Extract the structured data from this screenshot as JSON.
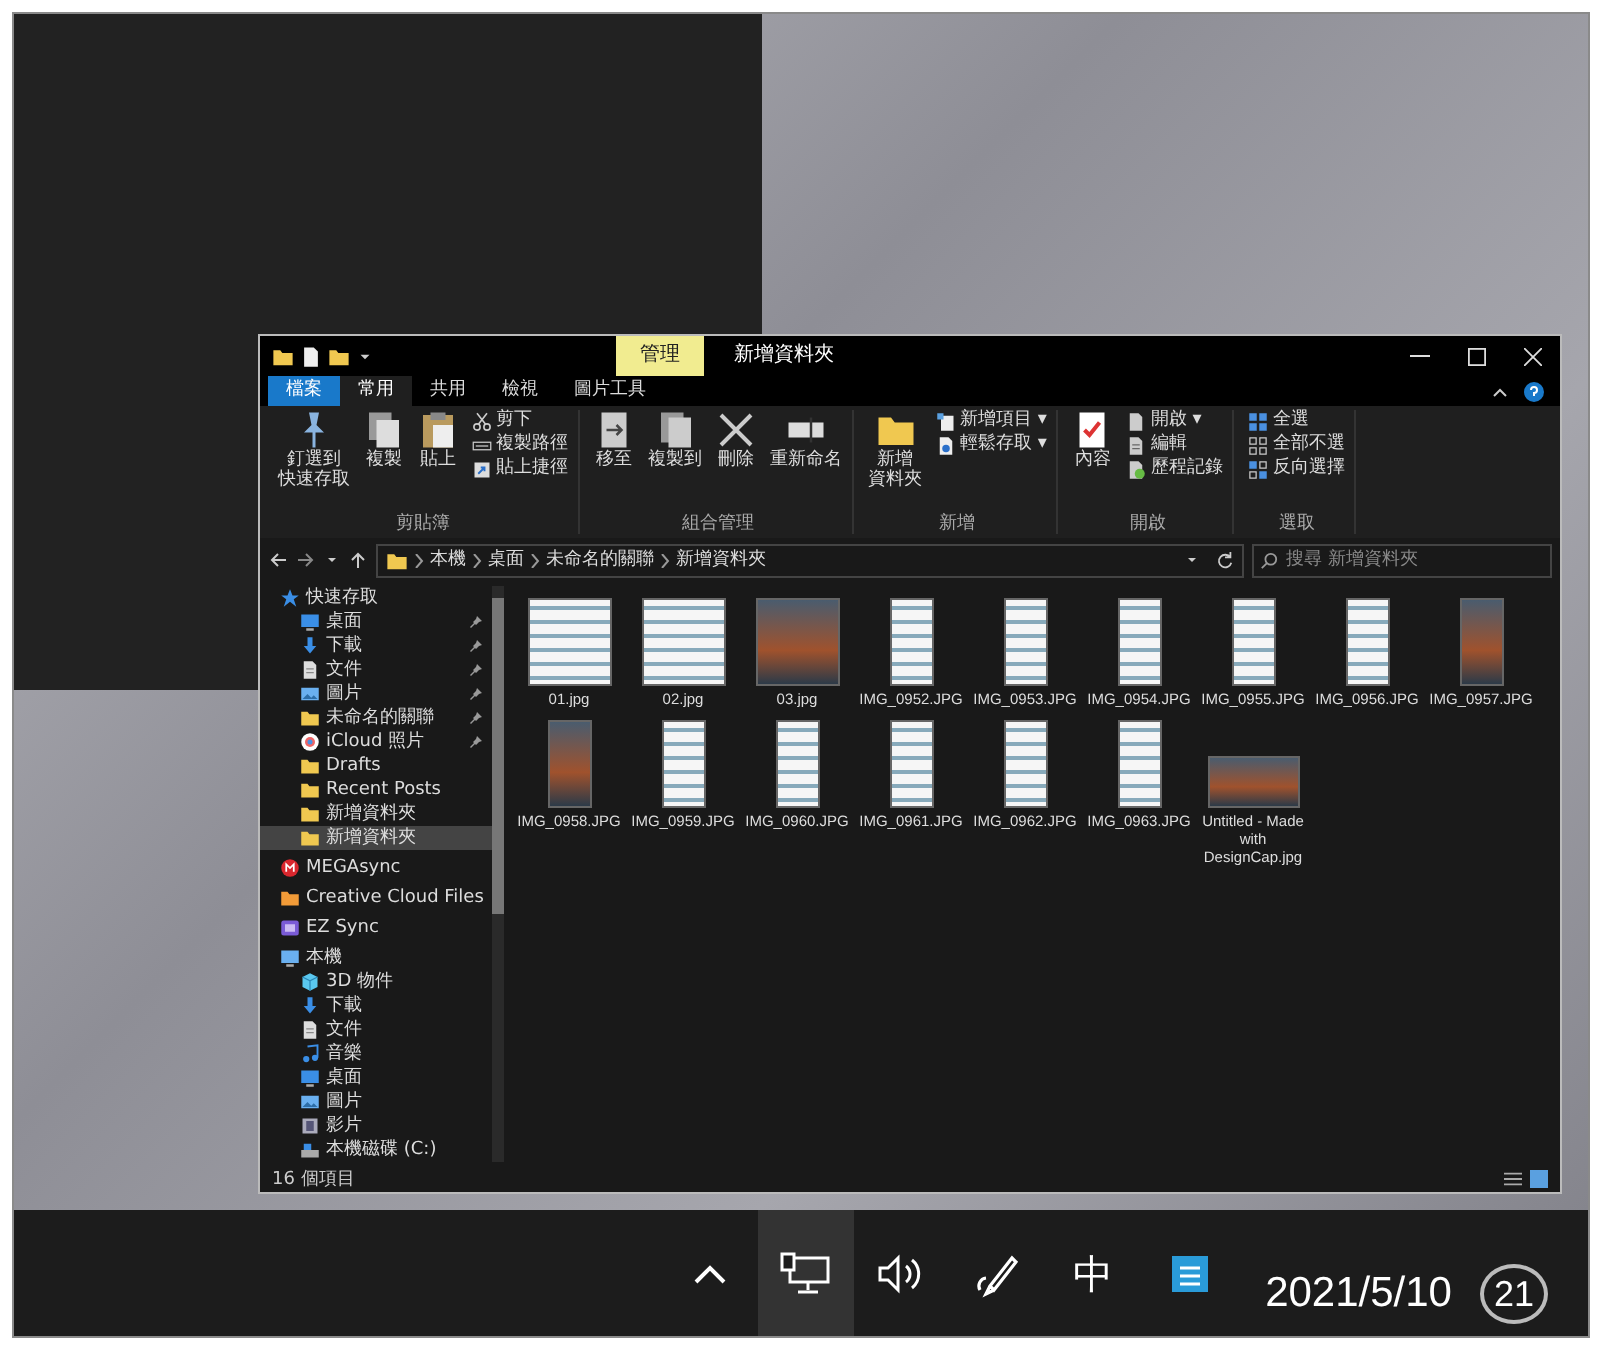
{
  "explorer": {
    "context_tab": "管理",
    "title": "新增資料夾",
    "ribbon_tabs": [
      {
        "label": "檔案",
        "kind": "file",
        "selected": false
      },
      {
        "label": "常用",
        "kind": "tab",
        "selected": true
      },
      {
        "label": "共用",
        "kind": "tab",
        "selected": false
      },
      {
        "label": "檢視",
        "kind": "tab",
        "selected": false
      },
      {
        "label": "圖片工具",
        "kind": "tab",
        "selected": false
      }
    ],
    "ribbon_groups": [
      {
        "name": "剪貼簿",
        "items": [
          {
            "lines": [
              "釘選到",
              "快速存取"
            ],
            "kind": "pin",
            "large": true
          },
          {
            "lines": [
              "複製"
            ],
            "kind": "copy",
            "large": true
          },
          {
            "lines": [
              "貼上"
            ],
            "kind": "paste",
            "large": true
          },
          {
            "lines": [
              "剪下"
            ],
            "kind": "cut",
            "large": false
          },
          {
            "lines": [
              "複製路徑"
            ],
            "kind": "path",
            "large": false
          },
          {
            "lines": [
              "貼上捷徑"
            ],
            "kind": "shortcut",
            "large": false
          }
        ]
      },
      {
        "name": "組合管理",
        "items": [
          {
            "lines": [
              "移至"
            ],
            "kind": "move",
            "large": true
          },
          {
            "lines": [
              "複製到"
            ],
            "kind": "copyto",
            "large": true
          },
          {
            "lines": [
              "刪除"
            ],
            "kind": "delete",
            "large": true
          },
          {
            "lines": [
              "重新命名"
            ],
            "kind": "rename",
            "large": true
          }
        ]
      },
      {
        "name": "新增",
        "items": [
          {
            "lines": [
              "新增",
              "資料夾"
            ],
            "kind": "folder",
            "large": true
          },
          {
            "lines": [
              "新增項目 ▾"
            ],
            "kind": "newitem",
            "large": false
          },
          {
            "lines": [
              "輕鬆存取 ▾"
            ],
            "kind": "easy",
            "large": false
          }
        ]
      },
      {
        "name": "開啟",
        "items": [
          {
            "lines": [
              "內容"
            ],
            "kind": "properties",
            "large": true
          },
          {
            "lines": [
              "開啟 ▾"
            ],
            "kind": "open",
            "large": false
          },
          {
            "lines": [
              "編輯"
            ],
            "kind": "edit",
            "large": false
          },
          {
            "lines": [
              "歷程記錄"
            ],
            "kind": "history",
            "large": false
          }
        ]
      },
      {
        "name": "選取",
        "items": [
          {
            "lines": [
              "全選"
            ],
            "kind": "selectall",
            "large": false
          },
          {
            "lines": [
              "全部不選"
            ],
            "kind": "selectnone",
            "large": false
          },
          {
            "lines": [
              "反向選擇"
            ],
            "kind": "invert",
            "large": false
          }
        ]
      }
    ],
    "breadcrumbs": [
      "本機",
      "桌面",
      "未命名的關聯",
      "新增資料夾"
    ],
    "search": {
      "placeholder": "搜尋 新增資料夾"
    },
    "sidebar": {
      "groups": [
        [
          {
            "label": "快速存取",
            "kind": "star",
            "pinned": false,
            "selected": false
          },
          {
            "label": "桌面",
            "kind": "desktop",
            "pinned": true,
            "selected": false
          },
          {
            "label": "下載",
            "kind": "download",
            "pinned": true,
            "selected": false
          },
          {
            "label": "文件",
            "kind": "document",
            "pinned": true,
            "selected": false
          },
          {
            "label": "圖片",
            "kind": "pictures",
            "pinned": true,
            "selected": false
          },
          {
            "label": "未命名的關聯",
            "kind": "folder",
            "pinned": true,
            "selected": false
          },
          {
            "label": "iCloud 照片",
            "kind": "cloud",
            "pinned": true,
            "selected": false
          },
          {
            "label": "Drafts",
            "kind": "folder",
            "pinned": false,
            "selected": false
          },
          {
            "label": "Recent Posts",
            "kind": "folder",
            "pinned": false,
            "selected": false
          },
          {
            "label": "新增資料夾",
            "kind": "folder",
            "pinned": false,
            "selected": false
          },
          {
            "label": "新增資料夾",
            "kind": "folder",
            "pinned": false,
            "selected": true
          }
        ],
        [
          {
            "label": "MEGAsync",
            "kind": "mega",
            "pinned": false,
            "selected": false
          }
        ],
        [
          {
            "label": "Creative Cloud Files",
            "kind": "cc",
            "pinned": false,
            "selected": false
          }
        ],
        [
          {
            "label": "EZ Sync",
            "kind": "ez",
            "pinned": false,
            "selected": false
          }
        ],
        [
          {
            "label": "本機",
            "kind": "pc",
            "pinned": false,
            "selected": false
          },
          {
            "label": "3D 物件",
            "kind": "cube",
            "pinned": false,
            "selected": false
          },
          {
            "label": "下載",
            "kind": "download",
            "pinned": false,
            "selected": false
          },
          {
            "label": "文件",
            "kind": "document",
            "pinned": false,
            "selected": false
          },
          {
            "label": "音樂",
            "kind": "music",
            "pinned": false,
            "selected": false
          },
          {
            "label": "桌面",
            "kind": "desktop",
            "pinned": false,
            "selected": false
          },
          {
            "label": "圖片",
            "kind": "pictures",
            "pinned": false,
            "selected": false
          },
          {
            "label": "影片",
            "kind": "film",
            "pinned": false,
            "selected": false
          },
          {
            "label": "本機磁碟 (C:)",
            "kind": "drive",
            "pinned": false,
            "selected": false
          }
        ]
      ]
    },
    "files": [
      {
        "name": "01.jpg",
        "kind": "wide",
        "dark": false
      },
      {
        "name": "02.jpg",
        "kind": "wide",
        "dark": false
      },
      {
        "name": "03.jpg",
        "kind": "wide",
        "dark": true
      },
      {
        "name": "IMG_0952.JPG",
        "kind": "tall",
        "dark": false
      },
      {
        "name": "IMG_0953.JPG",
        "kind": "tall",
        "dark": false
      },
      {
        "name": "IMG_0954.JPG",
        "kind": "tall",
        "dark": false
      },
      {
        "name": "IMG_0955.JPG",
        "kind": "tall",
        "dark": false
      },
      {
        "name": "IMG_0956.JPG",
        "kind": "tall",
        "dark": false
      },
      {
        "name": "IMG_0957.JPG",
        "kind": "tall",
        "dark": true
      },
      {
        "name": "IMG_0958.JPG",
        "kind": "tall",
        "dark": true
      },
      {
        "name": "IMG_0959.JPG",
        "kind": "tall",
        "dark": false
      },
      {
        "name": "IMG_0960.JPG",
        "kind": "tall",
        "dark": false
      },
      {
        "name": "IMG_0961.JPG",
        "kind": "tall",
        "dark": false
      },
      {
        "name": "IMG_0962.JPG",
        "kind": "tall",
        "dark": false
      },
      {
        "name": "IMG_0963.JPG",
        "kind": "tall",
        "dark": false
      },
      {
        "name": "Untitled - Made with DesignCap.jpg",
        "kind": "banner",
        "dark": true
      }
    ],
    "status": "16 個項目"
  },
  "taskbar": {
    "tray": [
      {
        "kind": "chevron",
        "selected": false
      },
      {
        "kind": "network",
        "selected": true
      },
      {
        "kind": "volume",
        "selected": false
      },
      {
        "kind": "pen",
        "selected": false
      },
      {
        "kind": "ime",
        "label": "中",
        "selected": false
      },
      {
        "kind": "notepad",
        "selected": false
      }
    ],
    "date": "2021/5/10",
    "notifications": "21"
  }
}
